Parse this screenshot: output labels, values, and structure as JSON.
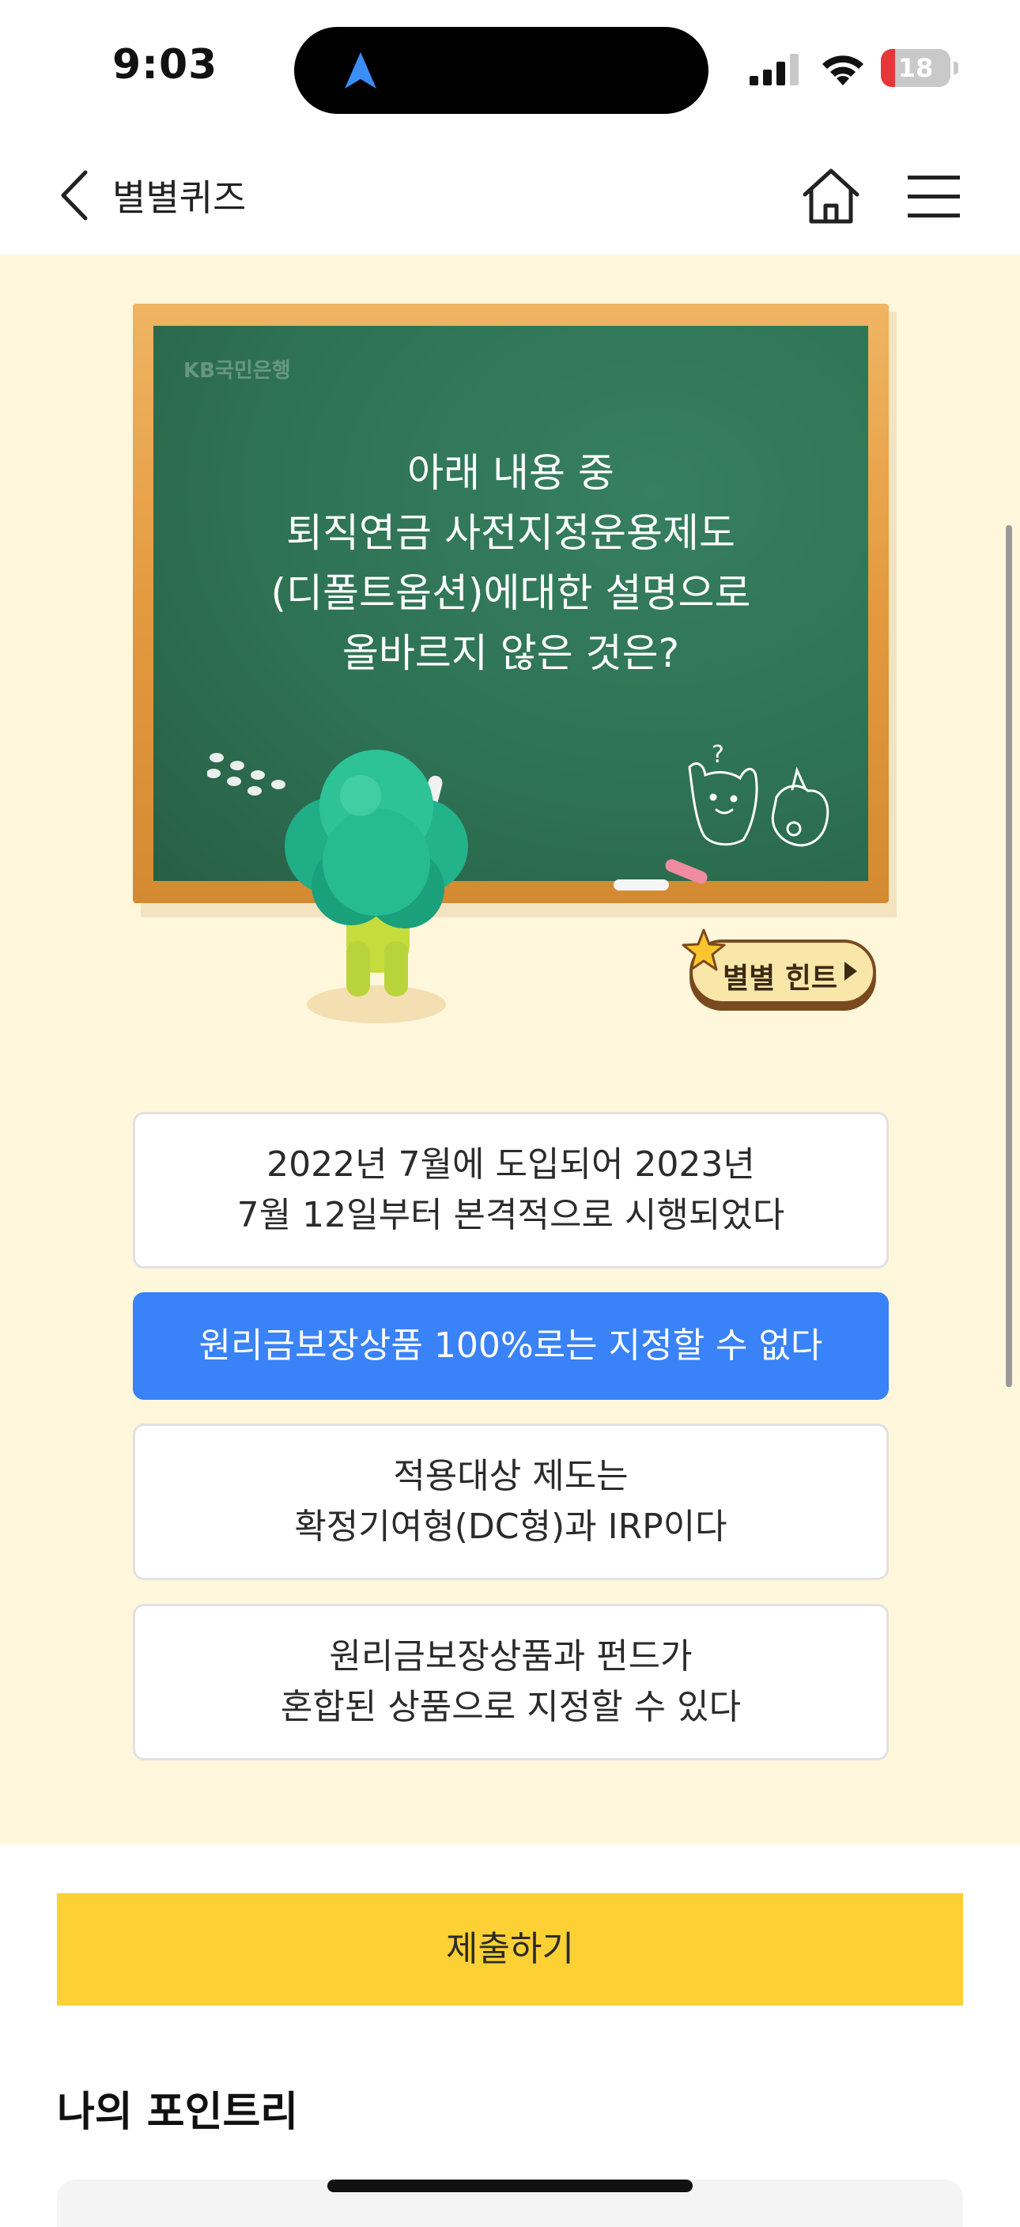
{
  "status_bar": {
    "time": "9:03",
    "battery_level": "18"
  },
  "header": {
    "title": "별별퀴즈"
  },
  "quiz": {
    "brand": "KB국민은행",
    "question_lines": [
      "아래 내용 중",
      "퇴직연금 사전지정운용제도",
      "(디폴트옵션)에대한 설명으로",
      "올바르지 않은 것은?"
    ],
    "hint_label": "별별 힌트"
  },
  "options": [
    {
      "lines": [
        "2022년 7월에 도입되어 2023년",
        "7월 12일부터 본격적으로 시행되었다"
      ],
      "selected": false
    },
    {
      "lines": [
        "원리금보장상품 100%로는 지정할 수 없다"
      ],
      "selected": true
    },
    {
      "lines": [
        "적용대상 제도는",
        "확정기여형(DC형)과 IRP이다"
      ],
      "selected": false
    },
    {
      "lines": [
        "원리금보장상품과 펀드가",
        "혼합된 상품으로 지정할 수 있다"
      ],
      "selected": false
    }
  ],
  "submit_label": "제출하기",
  "points_section_title": "나의 포인트리",
  "colors": {
    "panel_bg": "#fff7dc",
    "board_green": "#2e7254",
    "selected_blue": "#3a82f7",
    "submit_yellow": "#fdd133",
    "battery_red": "#e5373a"
  },
  "icons": [
    "location-arrow-icon",
    "cellular-signal-icon",
    "wifi-icon",
    "battery-icon",
    "back-chevron-icon",
    "home-icon",
    "menu-icon",
    "star-icon",
    "play-triangle-icon"
  ]
}
